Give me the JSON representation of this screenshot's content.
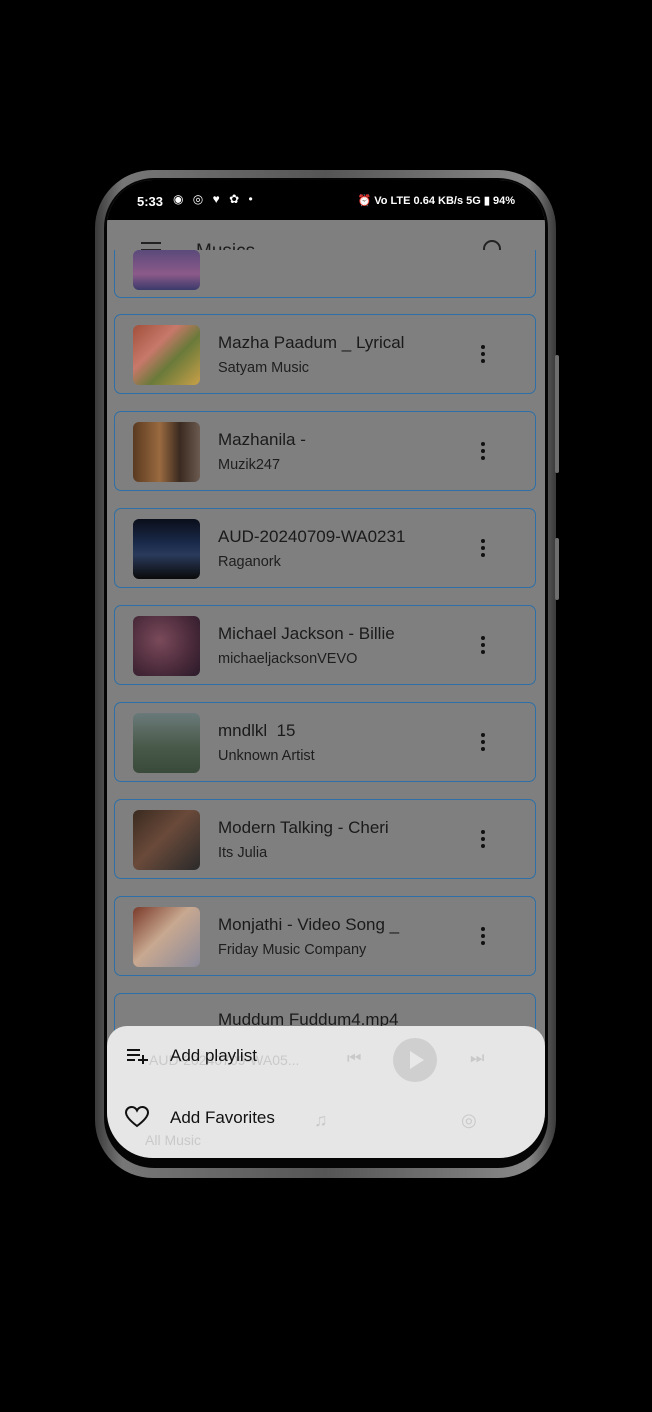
{
  "status_bar": {
    "time": "5:33",
    "left_icons": "◉ ◎ ♥ ✿ •",
    "right_icons": "⏰ Vo LTE 0.64 KB/s 5G ▮ 94%"
  },
  "app_bar": {
    "title": "Musics"
  },
  "songs": [
    {
      "title": "Mazha Paadum _ Lyrical",
      "artist": "Satyam Music"
    },
    {
      "title": "Mazhanila -",
      "artist": "Muzik247"
    },
    {
      "title": "AUD-20240709-WA0231",
      "artist": "Raganork"
    },
    {
      "title": "Michael Jackson - Billie",
      "artist": "michaeljacksonVEVO"
    },
    {
      "title": "mndlkl  15",
      "artist": "Unknown Artist"
    },
    {
      "title": "Modern Talking - Cheri",
      "artist": "Its Julia"
    },
    {
      "title": "Monjathi - Video Song _",
      "artist": "Friday Music Company"
    },
    {
      "title": "Muddum Fuddum4.mp4",
      "artist": ""
    }
  ],
  "mini_player": {
    "track": "AUD-20240709-WA05..."
  },
  "bottom_nav": {
    "all_music": "All Music"
  },
  "sheet": {
    "add_playlist": "Add playlist",
    "add_favorites": "Add Favorites"
  },
  "colors": {
    "accent": "#2d6fa6",
    "scrim": "#7f7f7f",
    "sheet": "#e6e6e6"
  }
}
